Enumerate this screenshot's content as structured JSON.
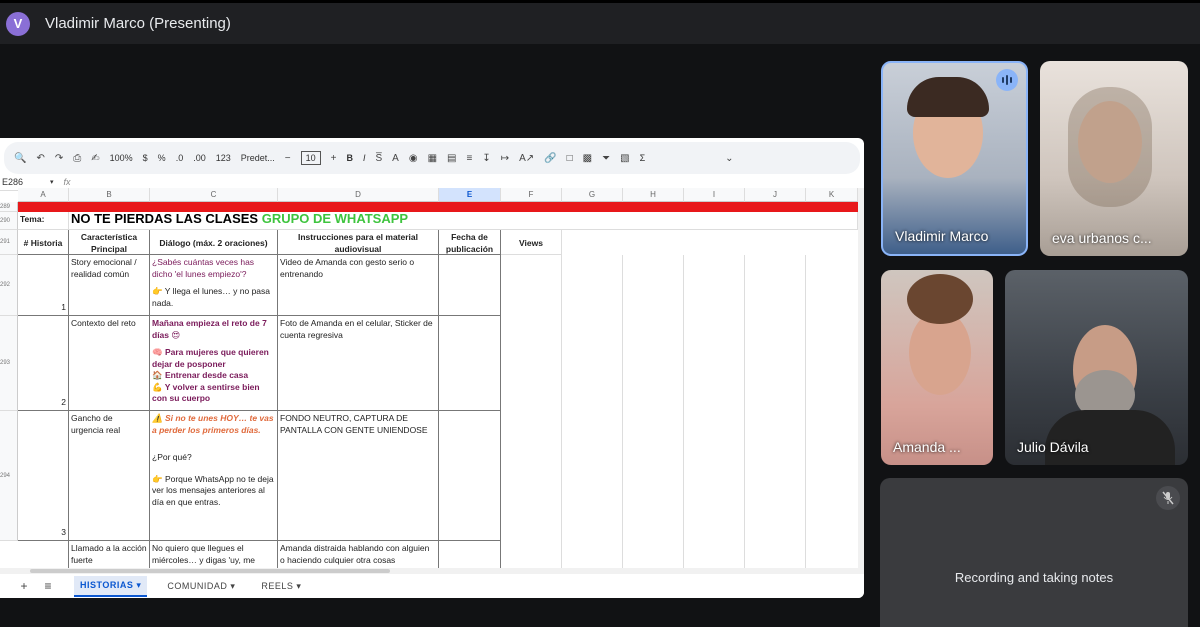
{
  "meeting": {
    "presenter_initial": "V",
    "presenter_label": "Vladimir Marco (Presenting)"
  },
  "sheet": {
    "toolbar": {
      "zoom": "100%",
      "currency": "$",
      "percent": "%",
      "dec_less": ".0",
      "dec_more": ".00",
      "format_123": "123",
      "font": "Predet...",
      "font_size": "10",
      "bold": "B",
      "italic": "I",
      "sum": "Σ"
    },
    "name_box": "E286",
    "fx": "fx",
    "columns": [
      "A",
      "B",
      "C",
      "D",
      "E",
      "F",
      "G",
      "H",
      "I",
      "J",
      "K"
    ],
    "row_numbers": [
      "289",
      "290",
      "291",
      "292",
      "293",
      "294"
    ],
    "tema_label": "Tema:",
    "title_main": "NO TE PIERDAS LAS CLASES ",
    "title_whatsapp": "GRUPO DE WHATSAPP",
    "headers": {
      "historia": "# Historia",
      "caracteristica": "Característica Principal",
      "dialogo": "Diálogo (máx. 2 oraciones)",
      "instrucciones": "Instrucciones para el material audiovisual",
      "fecha": "Fecha de publicación",
      "views": "Views"
    },
    "rows": [
      {
        "num": "1",
        "caracteristica": "Story emocional / realidad común",
        "dialogo_1": "¿Sabés cuántas veces has dicho 'el lunes empiezo'?",
        "dialogo_2": "👉 Y llega el lunes… y no pasa nada.",
        "instrucciones": "Video de Amanda con gesto serio o entrenando"
      },
      {
        "num": "2",
        "caracteristica": "Contexto del reto",
        "dialogo_1": "Mañana empieza el reto de 7 días 😍",
        "dialogo_2": "🧠 Para mujeres que quieren dejar de posponer",
        "dialogo_3": "🏠 Entrenar desde casa",
        "dialogo_4": "💪 Y volver a sentirse bien con su cuerpo",
        "instrucciones": " Foto de Amanda en el celular, Sticker de cuenta regresiva"
      },
      {
        "num": "3",
        "caracteristica": "Gancho de urgencia real",
        "dialogo_1": "⚠️ Si no te unes HOY… te vas a perder los primeros días.",
        "dialogo_2": "¿Por qué?",
        "dialogo_3": "👉 Porque WhatsApp no te deja ver los mensajes anteriores al día en que entras.",
        "instrucciones": "FONDO NEUTRO, CAPTURA DE PANTALLA CON GENTE UNIENDOSE"
      },
      {
        "num": "",
        "caracteristica": "Llamado a la acción fuerte",
        "dialogo_1": "No quiero que llegues el miércoles… y digas 'uy, me",
        "instrucciones": "Amanda distraida hablando con alguien o haciendo culquier otra cosas"
      }
    ],
    "tabs": [
      {
        "label": "HISTORIAS",
        "active": true
      },
      {
        "label": "COMUNIDAD",
        "active": false
      },
      {
        "label": "REELS",
        "active": false
      }
    ]
  },
  "participants": [
    {
      "name": "Vladimir Marco",
      "speaking": true
    },
    {
      "name": "eva urbanos c..."
    },
    {
      "name": "Amanda ..."
    },
    {
      "name": "Julio Dávila"
    }
  ],
  "notes_tile": {
    "text": "Recording and taking notes",
    "mic": "muted"
  },
  "colors": {
    "highlight_bar": "#e8181a",
    "whatsapp_green": "#3ec43e",
    "active_speaker": "#8ab4f8"
  }
}
